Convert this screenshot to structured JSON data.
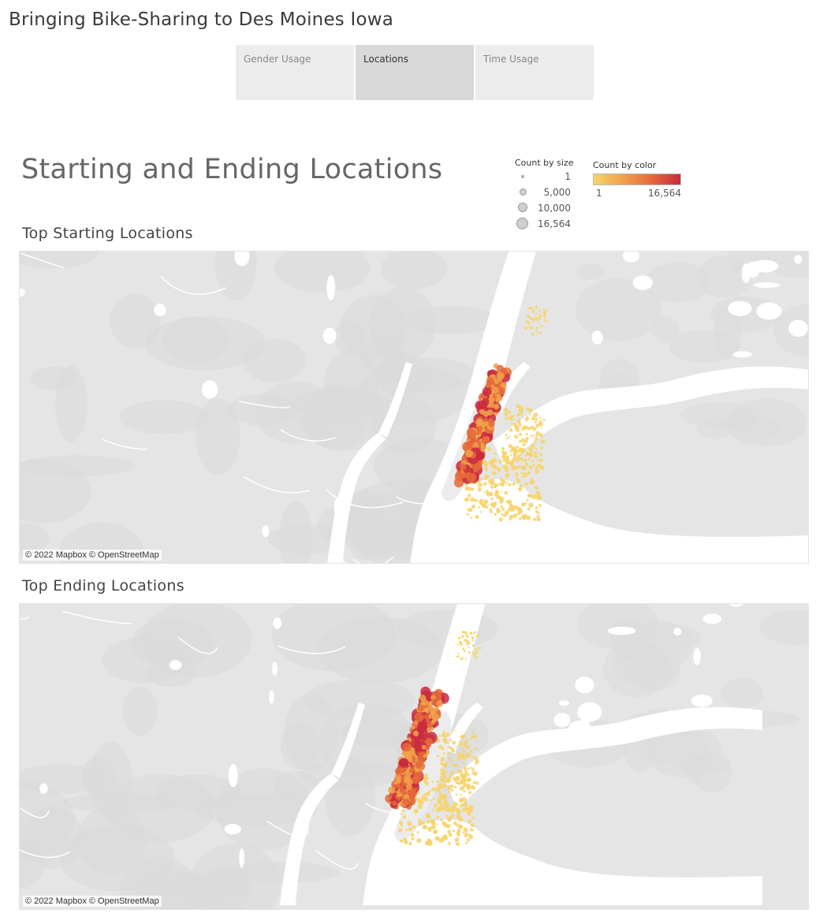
{
  "story": {
    "title": "Bringing Bike-Sharing to Des Moines Iowa"
  },
  "tabs": [
    {
      "label": "Gender Usage",
      "active": false
    },
    {
      "label": "Locations",
      "active": true
    },
    {
      "label": "Time Usage",
      "active": false
    }
  ],
  "dashboard": {
    "title": "Starting and Ending Locations"
  },
  "legend": {
    "size_title": "Count by size",
    "size_values": [
      "1",
      "5,000",
      "10,000",
      "16,564"
    ],
    "color_title": "Count by color",
    "color_min": "1",
    "color_max": "16,564",
    "colors": [
      "#f6d46b",
      "#f0a24a",
      "#e46a3b",
      "#c92a3e"
    ]
  },
  "maps": [
    {
      "title": "Top Starting Locations",
      "attribution": "© 2022 Mapbox © OpenStreetMap"
    },
    {
      "title": "Top Ending Locations",
      "attribution": "© 2022 Mapbox © OpenStreetMap"
    }
  ]
}
